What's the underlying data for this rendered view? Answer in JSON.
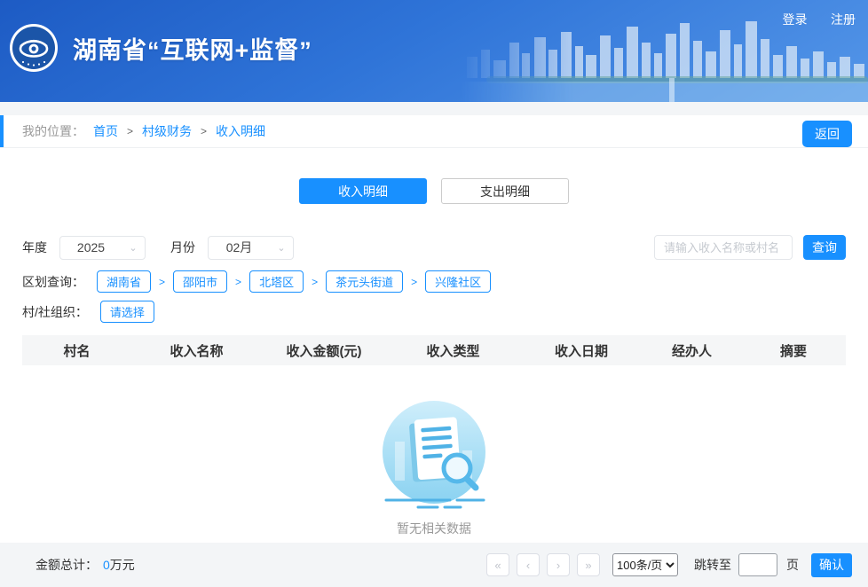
{
  "header": {
    "title": "湖南省“互联网+监督”",
    "login": "登录",
    "register": "注册"
  },
  "breadcrumb": {
    "label": "我的位置：",
    "items": [
      "首页",
      "村级财务",
      "收入明细"
    ],
    "separator": ">",
    "back_button": "返回"
  },
  "tabs": {
    "income": "收入明细",
    "expense": "支出明细"
  },
  "filters": {
    "year_label": "年度",
    "year_value": "2025",
    "month_label": "月份",
    "month_value": "02月",
    "chevron": "⌄",
    "search_placeholder": "请输入收入名称或村名",
    "search_button": "查询",
    "district_label": "区划查询：",
    "district_items": [
      "湖南省",
      "邵阳市",
      "北塔区",
      "茶元头街道",
      "兴隆社区"
    ],
    "district_separator": ">",
    "village_label": "村/社组织：",
    "village_select": "请选择"
  },
  "table": {
    "columns": [
      "村名",
      "收入名称",
      "收入金额(元)",
      "收入类型",
      "收入日期",
      "经办人",
      "摘要"
    ],
    "empty_text": "暂无相关数据"
  },
  "footer": {
    "total_label": "金额总计：",
    "total_value": "0",
    "total_unit": "万元",
    "pagination": {
      "first": "«",
      "prev": "‹",
      "next": "›",
      "last": "»",
      "page_size": "100条/页",
      "jump_label": "跳转至",
      "page_unit": "页",
      "confirm_button": "确认"
    }
  },
  "colors": {
    "primary": "#1890ff",
    "header_gradient_start": "#1d5bc4",
    "header_gradient_end": "#5496e8"
  }
}
